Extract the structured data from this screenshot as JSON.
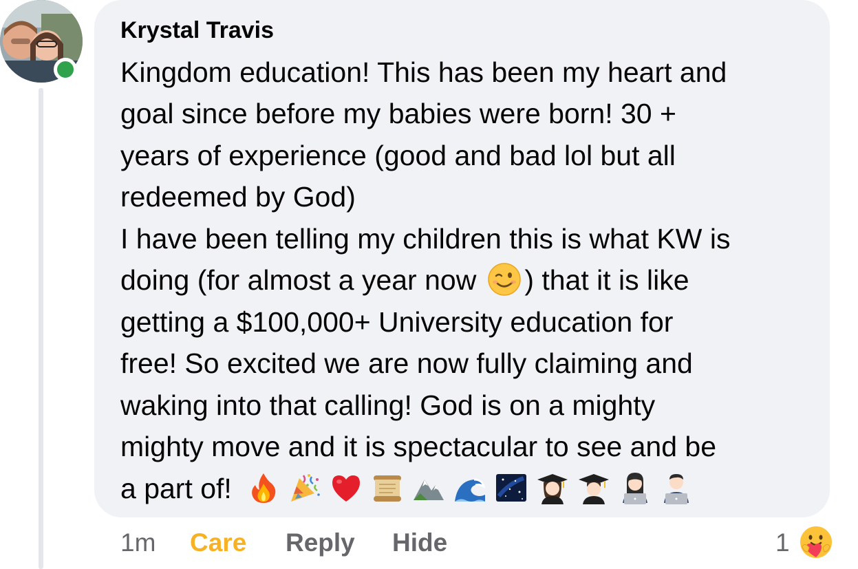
{
  "comment": {
    "author": "Krystal Travis",
    "lines": [
      "Kingdom education! This has been my heart and",
      "goal since before my babies were born! 30 +",
      "years of experience (good and bad lol but all",
      "redeemed by God)",
      "I have been telling my children this is what KW is",
      "",
      "getting a $100,000+ University education for",
      "free! So excited we are now fully claiming and",
      "waking into that calling! God is on a mighty",
      "mighty move and it is spectacular to see and be",
      ""
    ],
    "line6_before": "doing  (for almost a year now",
    "line6_after": ") that it is like",
    "last_line_text": "a part of!",
    "emojis": [
      "fire-emoji",
      "party-popper-emoji",
      "heart-emoji",
      "scroll-emoji",
      "mountain-emoji",
      "wave-emoji",
      "stars-emoji",
      "graduate-woman-emoji",
      "graduate-man-emoji",
      "technologist-woman-emoji",
      "technologist-man-emoji"
    ]
  },
  "actions": {
    "time": "1m",
    "reaction_given": "Care",
    "reply": "Reply",
    "hide": "Hide"
  },
  "reactions": {
    "count": "1",
    "icon": "care-reaction-icon"
  },
  "colors": {
    "bubble": "#f0f2f5",
    "online": "#31a24c",
    "care": "#f7b125",
    "secondary": "#65676b"
  }
}
